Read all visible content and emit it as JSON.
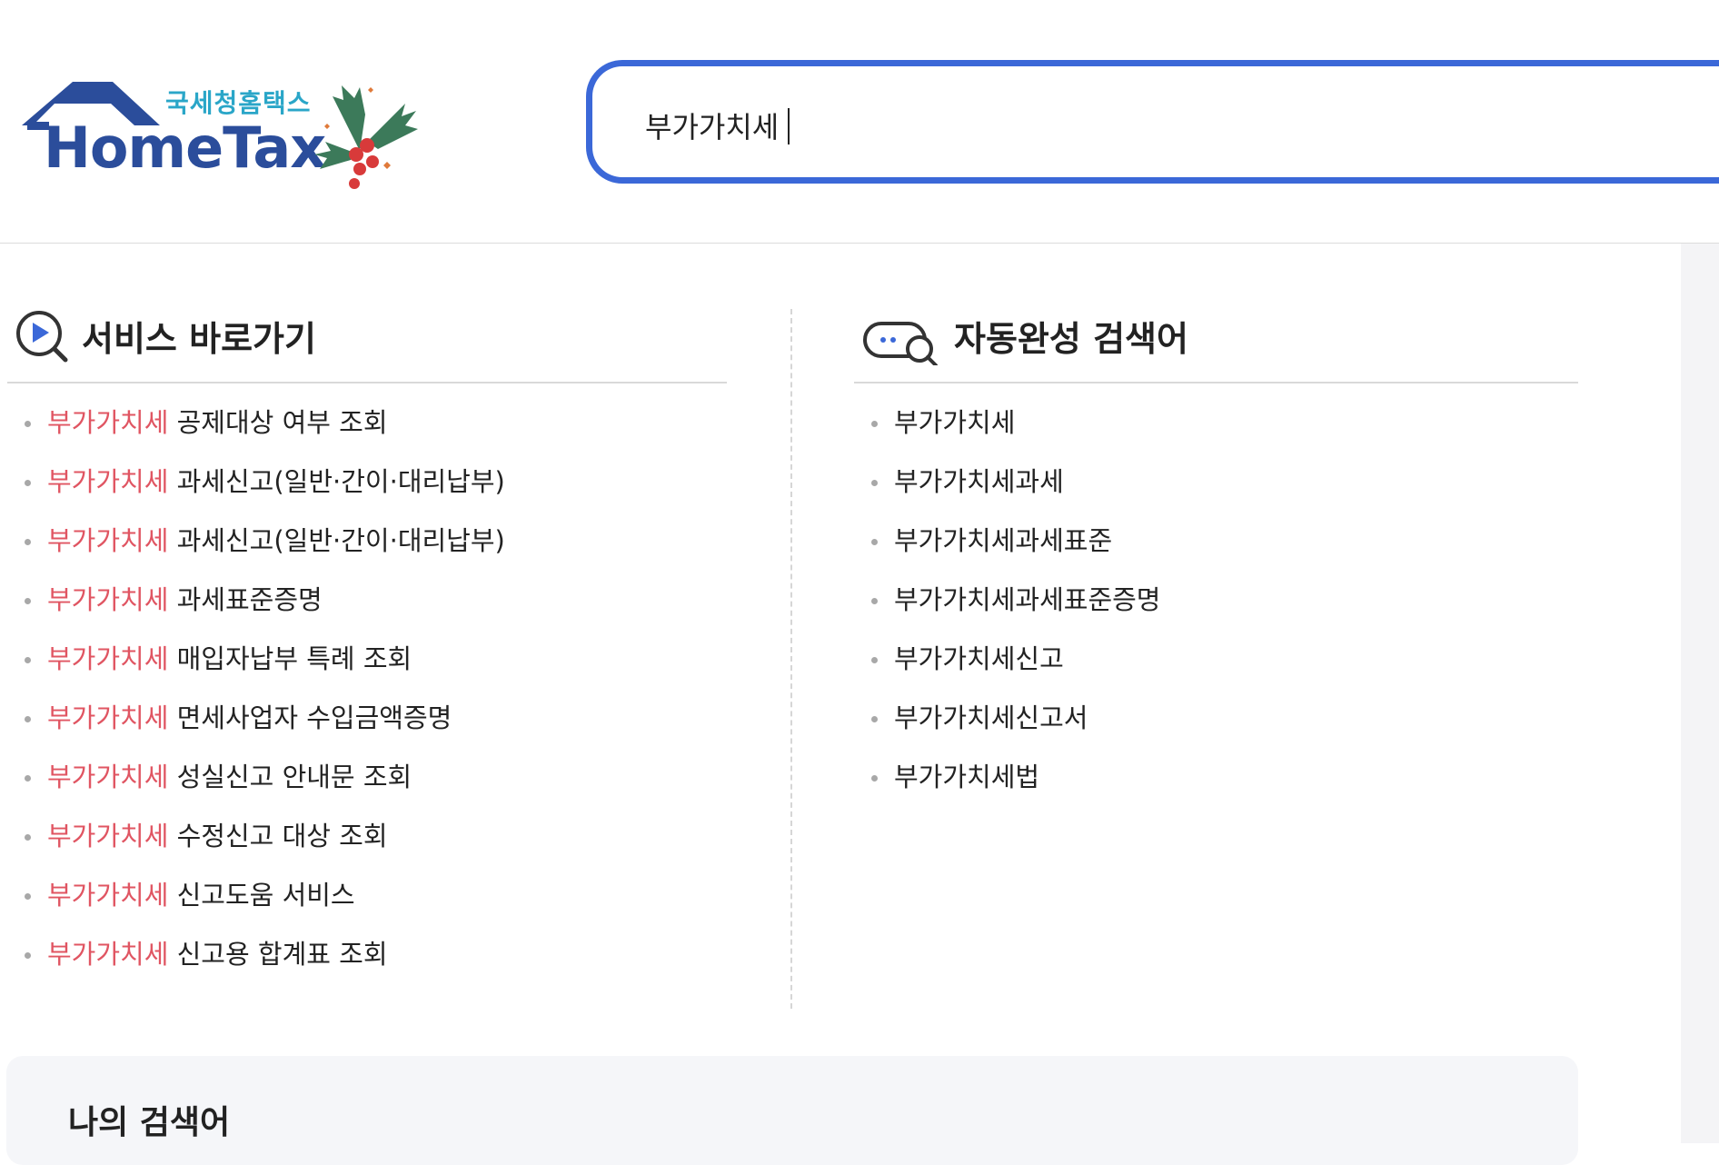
{
  "header": {
    "logo_text_ko": "국세청홈택스",
    "logo_text_en": "HomeTax",
    "search_value": "부가가치세"
  },
  "service": {
    "title": "서비스 바로가기",
    "items": [
      {
        "highlight": "부가가치세",
        "rest": " 공제대상 여부 조회"
      },
      {
        "highlight": "부가가치세",
        "rest": " 과세신고(일반·간이·대리납부)"
      },
      {
        "highlight": "부가가치세",
        "rest": " 과세신고(일반·간이·대리납부)"
      },
      {
        "highlight": "부가가치세",
        "rest": " 과세표준증명"
      },
      {
        "highlight": "부가가치세",
        "rest": " 매입자납부 특례 조회"
      },
      {
        "highlight": "부가가치세",
        "rest": " 면세사업자 수입금액증명"
      },
      {
        "highlight": "부가가치세",
        "rest": " 성실신고 안내문 조회"
      },
      {
        "highlight": "부가가치세",
        "rest": " 수정신고 대상 조회"
      },
      {
        "highlight": "부가가치세",
        "rest": " 신고도움 서비스"
      },
      {
        "highlight": "부가가치세",
        "rest": " 신고용 합계표 조회"
      }
    ]
  },
  "autocomplete": {
    "title": "자동완성 검색어",
    "items": [
      "부가가치세",
      "부가가치세과세",
      "부가가치세과세표준",
      "부가가치세과세표준증명",
      "부가가치세신고",
      "부가가치세신고서",
      "부가가치세법"
    ]
  },
  "my_search": {
    "title": "나의 검색어"
  },
  "colors": {
    "accent": "#3b68d8",
    "highlight": "#e05562",
    "logo_blue": "#2b4d9b",
    "logo_teal": "#2aa6c8"
  }
}
